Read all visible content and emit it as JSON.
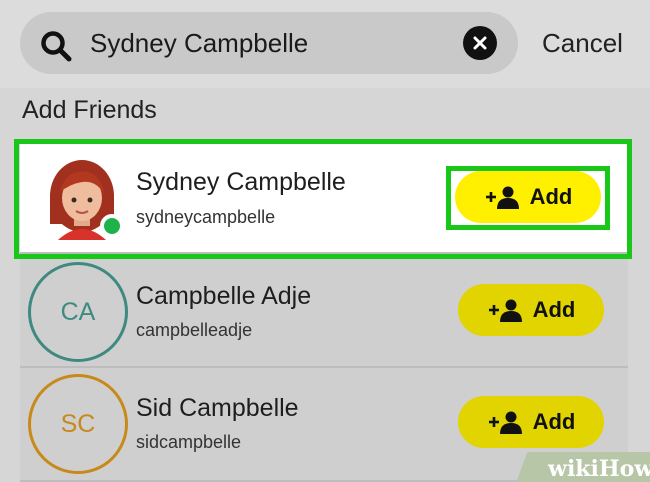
{
  "search": {
    "query": "Sydney Campbelle",
    "cancel_label": "Cancel"
  },
  "section": {
    "title": "Add Friends"
  },
  "results": [
    {
      "name": "Sydney Campbelle",
      "username": "sydneycampbelle",
      "initials": "",
      "avatar": "bitmoji-avatar",
      "online": true,
      "add_label": "Add",
      "highlighted": true
    },
    {
      "name": "Campbelle Adje",
      "username": "campbelleadje",
      "initials": "CA",
      "avatar_color": "#3f8a80",
      "add_label": "Add"
    },
    {
      "name": "Sid Campbelle",
      "username": "sidcampbelle",
      "initials": "SC",
      "avatar_color": "#c78a1a",
      "add_label": "Add"
    }
  ],
  "watermark": {
    "text": "wikiHow"
  },
  "colors": {
    "highlight": "#19c719",
    "add_button": "#fff000",
    "online": "#1db34a"
  }
}
